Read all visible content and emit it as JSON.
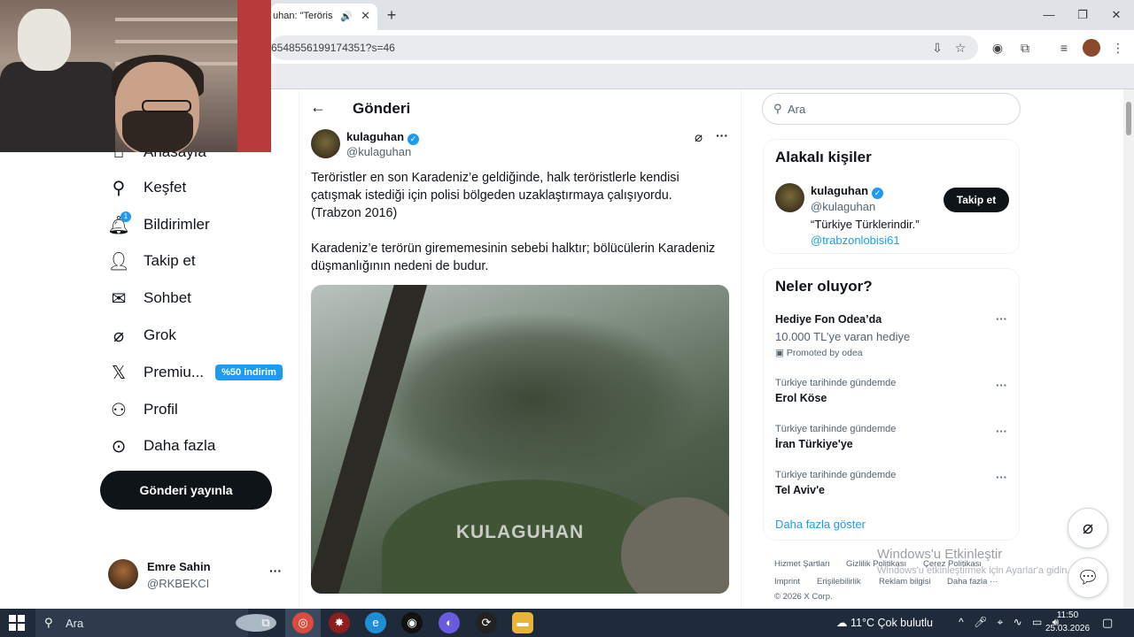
{
  "browser": {
    "tab_title": "uhan: \"Teröris",
    "new_tab": "+",
    "url": "6548556199174351?s=46",
    "window_controls": [
      "—",
      "❐",
      "✕"
    ]
  },
  "nav": {
    "items": [
      {
        "label": "Anasayfa",
        "icon": "home-icon"
      },
      {
        "label": "Keşfet",
        "icon": "search-icon"
      },
      {
        "label": "Bildirimler",
        "icon": "bell-icon",
        "badge": "1"
      },
      {
        "label": "Takip et",
        "icon": "person-add-icon"
      },
      {
        "label": "Sohbet",
        "icon": "mail-icon"
      },
      {
        "label": "Grok",
        "icon": "grok-icon"
      },
      {
        "label": "Premiu...",
        "icon": "x-logo-icon"
      },
      {
        "label": "Profil",
        "icon": "person-icon"
      },
      {
        "label": "Daha fazla",
        "icon": "more-circle-icon"
      }
    ],
    "premium_badge": "%50 indirim",
    "post_button": "Gönderi yayınla",
    "account": {
      "name": "Emre Sahin",
      "handle": "@RKBEKCI",
      "more": "···"
    }
  },
  "post": {
    "page_title": "Gönderi",
    "author_name": "kulaguhan",
    "author_handle": "@kulaguhan",
    "more": "···",
    "text_p1_l1": "Teröristler en son Karadeniz’e geldiğinde, halk teröristlerle kendisi",
    "text_p1_l2": "çatışmak istediği için polisi bölgeden uzaklaştırmaya çalışıyordu.",
    "text_p1_l3": "(Trabzon 2016)",
    "text_p2_l1": "Karadeniz’e terörün girememesinin sebebi halktır; bölücülerin Karadeniz",
    "text_p2_l2": "düşmanlığının nedeni de budur.",
    "video_watermark": "KULAGUHAN"
  },
  "right": {
    "search_placeholder": "Ara",
    "relevant_title": "Alakalı kişiler",
    "rp_name": "kulaguhan",
    "rp_handle": "@kulaguhan",
    "rp_bio": "“Türkiye Türklerindir.”",
    "rp_link": "@trabzonlobisi61",
    "follow_label": "Takip et",
    "trends_title": "Neler oluyor?",
    "promo_title": "Hediye Fon Odea’da",
    "promo_sub": "10.000 TL’ye varan hediye",
    "promo_by": "Promoted by odea",
    "trends": [
      {
        "category": "Türkiye tarihinde gündemde",
        "name": "Erol Köse"
      },
      {
        "category": "Türkiye tarihinde gündemde",
        "name": "İran Türkiye'ye"
      },
      {
        "category": "Türkiye tarihinde gündemde",
        "name": "Tel Aviv'e"
      }
    ],
    "trend_more": "···",
    "show_more": "Daha fazla göster",
    "footer": [
      "Hizmet Şartları",
      "Gizlilik Politikası",
      "Çerez Politikası",
      "Imprint",
      "Erişilebilirlik",
      "Reklam bilgisi",
      "Daha fazla ···",
      "© 2026 X Corp."
    ]
  },
  "watermark": {
    "title": "Windows'u Etkinleştir",
    "sub": "Windows'u etkinleştirmek için Ayarlar'a gidin."
  },
  "taskbar": {
    "search_placeholder": "Ara",
    "weather": "11°C  Çok bulutlu",
    "time": "11:50",
    "date": "25.03.2026"
  }
}
